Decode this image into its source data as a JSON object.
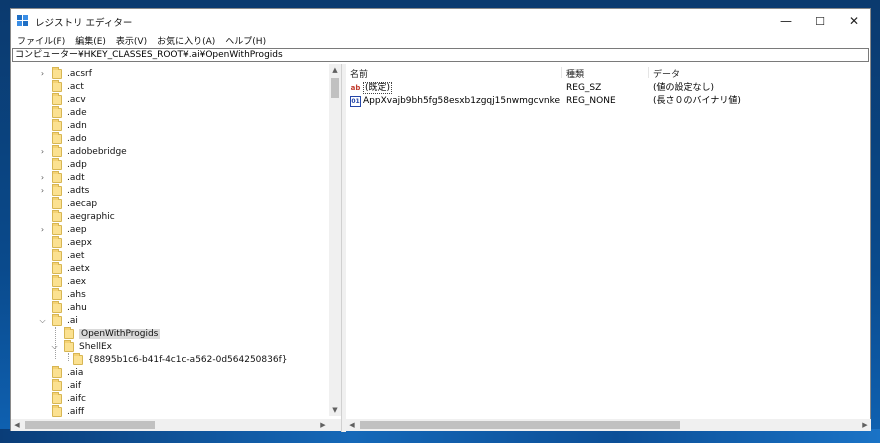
{
  "window": {
    "title": "レジストリ エディター",
    "minimize": "—",
    "maximize": "☐",
    "close": "✕"
  },
  "menu": [
    "ファイル(F)",
    "編集(E)",
    "表示(V)",
    "お気に入り(A)",
    "ヘルプ(H)"
  ],
  "address": "コンピューター¥HKEY_CLASSES_ROOT¥.ai¥OpenWithProgids",
  "tree": [
    {
      "label": ".acsrf",
      "level": 0,
      "expander": ">",
      "selected": false
    },
    {
      "label": ".act",
      "level": 0,
      "expander": "",
      "selected": false
    },
    {
      "label": ".acv",
      "level": 0,
      "expander": "",
      "selected": false
    },
    {
      "label": ".ade",
      "level": 0,
      "expander": "",
      "selected": false
    },
    {
      "label": ".adn",
      "level": 0,
      "expander": "",
      "selected": false
    },
    {
      "label": ".ado",
      "level": 0,
      "expander": "",
      "selected": false
    },
    {
      "label": ".adobebridge",
      "level": 0,
      "expander": ">",
      "selected": false
    },
    {
      "label": ".adp",
      "level": 0,
      "expander": "",
      "selected": false
    },
    {
      "label": ".adt",
      "level": 0,
      "expander": ">",
      "selected": false
    },
    {
      "label": ".adts",
      "level": 0,
      "expander": ">",
      "selected": false
    },
    {
      "label": ".aecap",
      "level": 0,
      "expander": "",
      "selected": false
    },
    {
      "label": ".aegraphic",
      "level": 0,
      "expander": "",
      "selected": false
    },
    {
      "label": ".aep",
      "level": 0,
      "expander": ">",
      "selected": false
    },
    {
      "label": ".aepx",
      "level": 0,
      "expander": "",
      "selected": false
    },
    {
      "label": ".aet",
      "level": 0,
      "expander": "",
      "selected": false
    },
    {
      "label": ".aetx",
      "level": 0,
      "expander": "",
      "selected": false
    },
    {
      "label": ".aex",
      "level": 0,
      "expander": "",
      "selected": false
    },
    {
      "label": ".ahs",
      "level": 0,
      "expander": "",
      "selected": false
    },
    {
      "label": ".ahu",
      "level": 0,
      "expander": "",
      "selected": false
    },
    {
      "label": ".ai",
      "level": 0,
      "expander": "v",
      "selected": false
    },
    {
      "label": "OpenWithProgids",
      "level": 1,
      "expander": "",
      "selected": true
    },
    {
      "label": "ShellEx",
      "level": 1,
      "expander": "v",
      "selected": false
    },
    {
      "label": "{8895b1c6-b41f-4c1c-a562-0d564250836f}",
      "level": 2,
      "expander": "",
      "selected": false
    },
    {
      "label": ".aia",
      "level": 0,
      "expander": "",
      "selected": false
    },
    {
      "label": ".aif",
      "level": 0,
      "expander": "",
      "selected": false
    },
    {
      "label": ".aifc",
      "level": 0,
      "expander": "",
      "selected": false
    },
    {
      "label": ".aiff",
      "level": 0,
      "expander": "",
      "selected": false
    }
  ],
  "list": {
    "headers": {
      "name": "名前",
      "type": "種類",
      "data": "データ"
    },
    "rows": [
      {
        "icon": "string-value-icon",
        "icon_glyph": "ab",
        "name": "(既定)",
        "type": "REG_SZ",
        "data": "(値の設定なし)"
      },
      {
        "icon": "binary-value-icon",
        "icon_glyph": "01",
        "name": "AppXvajb9bh5fg58esxb1zgqj15nwmgcvnke",
        "type": "REG_NONE",
        "data": "(長さ０のバイナリ値)"
      }
    ]
  },
  "scroll": {
    "up": "▲",
    "down": "▼",
    "left": "◀",
    "right": "▶"
  }
}
